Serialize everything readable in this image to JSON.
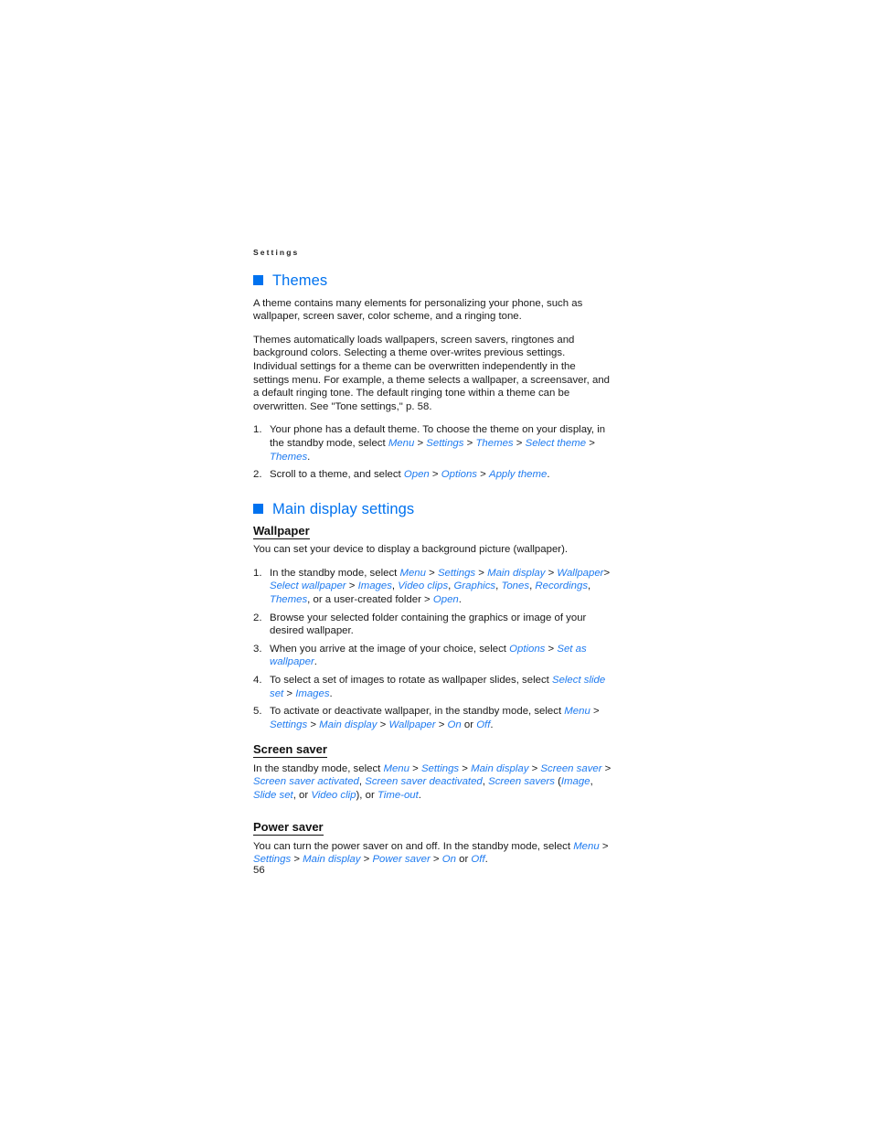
{
  "page": {
    "running_head": "Settings",
    "page_number": "56",
    "accent_color": "#0072ef",
    "link_color": "#1f7bf0",
    "text_color": "#1a1a1a"
  },
  "sections": [
    {
      "id": "themes",
      "heading": "Themes",
      "bullet_icon": "square-bullet-icon",
      "paragraphs": [
        "A theme contains many elements for personalizing your phone, such as wallpaper, screen saver, color scheme, and a ringing tone.",
        "Themes automatically loads wallpapers, screen savers, ringtones and background colors. Selecting a theme over-writes previous settings. Individual settings for a theme can be overwritten independently in the settings menu. For example, a theme selects a wallpaper, a screensaver, and a default ringing tone. The default ringing tone within a theme can be overwritten. See \"Tone settings,\" p. 58."
      ],
      "steps": [
        {
          "number": "1.",
          "lead": "Your phone has a default theme. To choose the theme on your display, in the standby mode, select ",
          "path": [
            "Menu",
            "Settings",
            "Themes",
            "Select theme",
            "Themes"
          ],
          "tail": "."
        },
        {
          "number": "2.",
          "lead": "Scroll to a theme, and select ",
          "path": [
            "Open",
            "Options",
            "Apply theme"
          ],
          "tail": "."
        }
      ]
    },
    {
      "id": "main-display-settings",
      "heading": "Main display settings",
      "bullet_icon": "square-bullet-icon",
      "subsections": [
        {
          "id": "wallpaper",
          "heading": "Wallpaper",
          "intro": "You can set your device to display a background picture (wallpaper).",
          "steps": [
            {
              "number": "1.",
              "lead": "In the standby mode, select ",
              "path": [
                "Menu",
                "Settings",
                "Main display",
                "Wallpaper",
                "Select wallpaper"
              ],
              "list": [
                "Images",
                "Video clips",
                "Graphics",
                "Tones",
                "Recordings",
                "Themes"
              ],
              "after_list": ", or a user-created folder > ",
              "final": "Open",
              "tail": "."
            },
            {
              "number": "2.",
              "lead": "Browse your selected folder containing the graphics or image of your desired wallpaper.",
              "path": [],
              "tail": ""
            },
            {
              "number": "3.",
              "lead": "When you arrive at the image of your choice, select ",
              "path": [
                "Options",
                "Set as wallpaper"
              ],
              "tail": "."
            },
            {
              "number": "4.",
              "lead": "To select a set of images to rotate as wallpaper slides, select ",
              "path": [
                "Select slide set",
                "Images"
              ],
              "tail": "."
            },
            {
              "number": "5.",
              "lead": "To activate or deactivate wallpaper, in the standby mode, select ",
              "path": [
                "Menu",
                "Settings",
                "Main display",
                "Wallpaper",
                "On"
              ],
              "or_label": " or ",
              "alt": "Off",
              "tail": "."
            }
          ]
        },
        {
          "id": "screen-saver",
          "heading": "Screen saver",
          "paragraph": {
            "lead": "In the standby mode, select ",
            "path": [
              "Menu",
              "Settings",
              "Main display",
              "Screen saver"
            ],
            "list": [
              "Screen saver activated",
              "Screen saver deactivated",
              "Screen savers"
            ],
            "paren_open": " (",
            "paren_items": [
              "Image",
              "Slide set"
            ],
            "paren_or": ", or ",
            "paren_last": "Video clip",
            "paren_close": "), or ",
            "final": "Time-out",
            "tail": "."
          }
        },
        {
          "id": "power-saver",
          "heading": "Power saver",
          "paragraph": {
            "lead": "You can turn the power saver on and off. In the standby mode, select ",
            "path": [
              "Menu",
              "Settings",
              "Main display",
              "Power saver",
              "On"
            ],
            "or_label": " or ",
            "alt": "Off",
            "tail": "."
          }
        }
      ]
    }
  ]
}
